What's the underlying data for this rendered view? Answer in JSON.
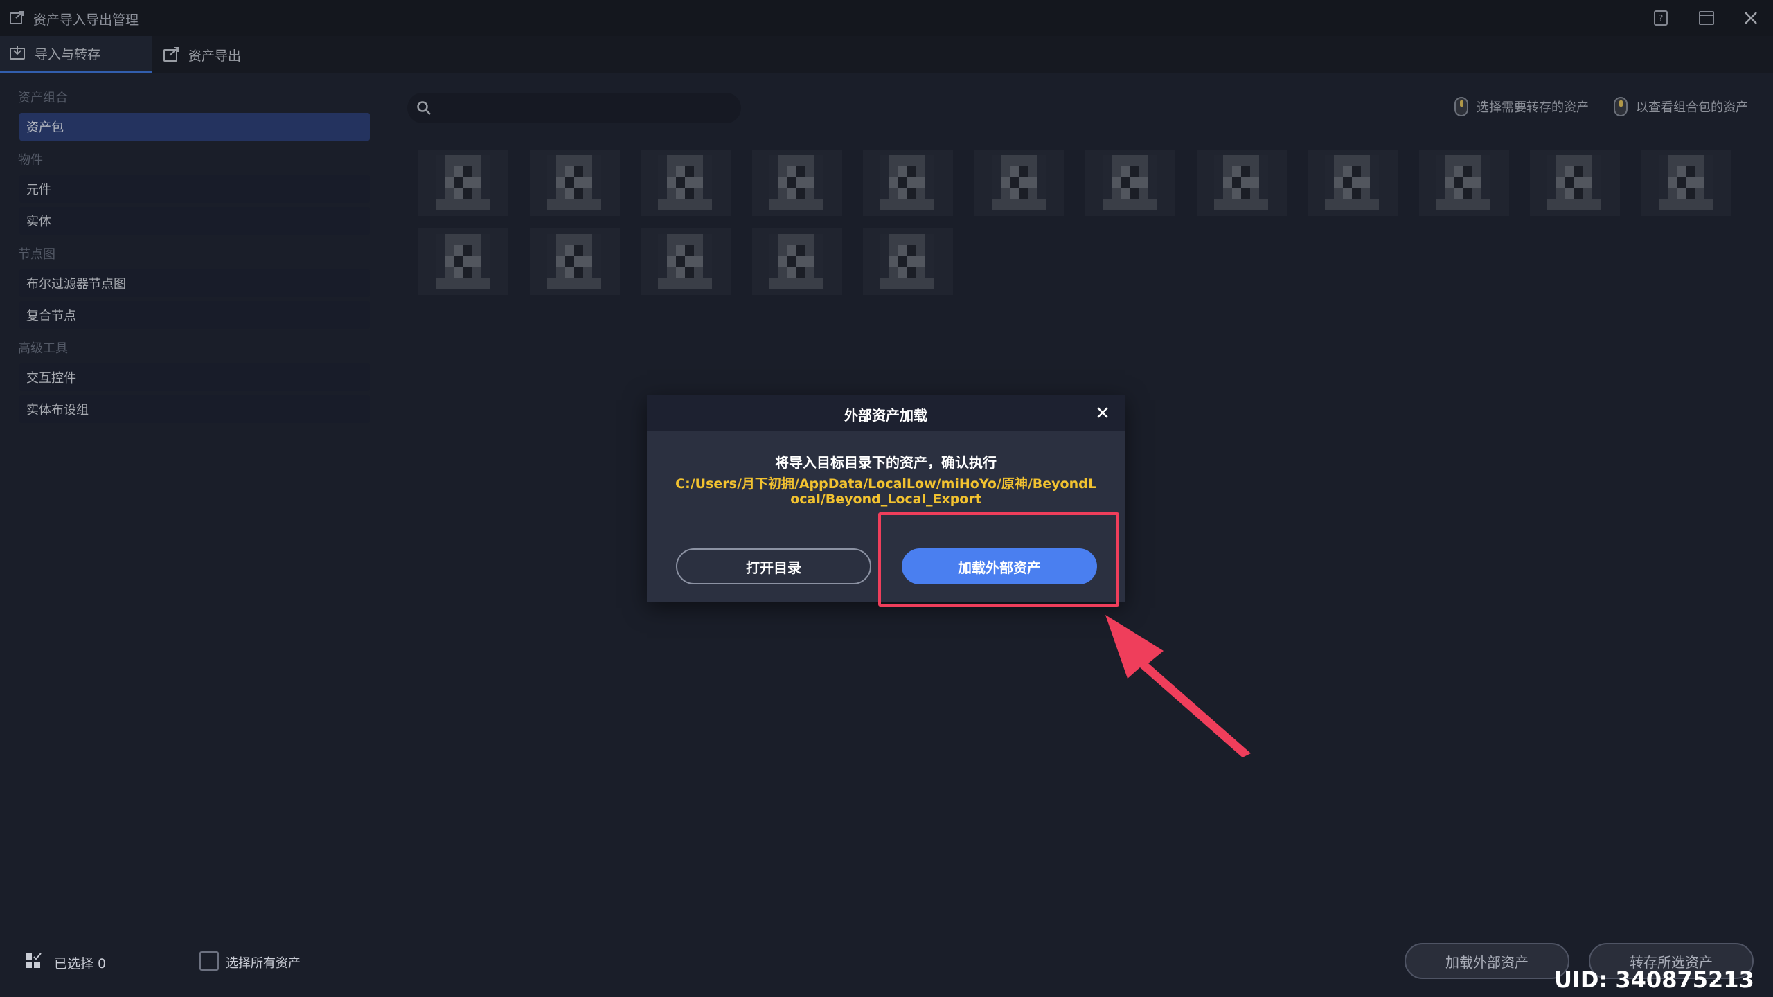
{
  "window": {
    "title": "资产导入导出管理",
    "icons": [
      "export-icon",
      "help-icon",
      "minimize-icon",
      "close-icon"
    ]
  },
  "tabs": [
    {
      "label": "导入与转存",
      "icon": "import-icon",
      "active": true
    },
    {
      "label": "资产导出",
      "icon": "export-icon",
      "active": false
    }
  ],
  "sidebar": {
    "groups": [
      {
        "title": "资产组合",
        "items": [
          {
            "label": "资产包",
            "selected": true
          }
        ]
      },
      {
        "title": "物件",
        "items": [
          {
            "label": "元件"
          },
          {
            "label": "实体"
          }
        ]
      },
      {
        "title": "节点图",
        "items": [
          {
            "label": "布尔过滤器节点图"
          },
          {
            "label": "复合节点"
          }
        ]
      },
      {
        "title": "高级工具",
        "items": [
          {
            "label": "交互控件"
          },
          {
            "label": "实体布设组"
          }
        ]
      }
    ]
  },
  "search": {
    "placeholder": "",
    "value": "",
    "icon": "search-icon"
  },
  "hints": [
    {
      "icon": "mouse-left-icon",
      "label": "选择需要转存的资产"
    },
    {
      "icon": "mouse-right-icon",
      "label": "以查看组合包的资产"
    }
  ],
  "assets": {
    "row1_count": 12,
    "row2_count": 5
  },
  "dialog": {
    "title": "外部资产加载",
    "message": "将导入目标目录下的资产，确认执行",
    "path": "C:/Users/月下初拥/AppData/LocalLow/miHoYo/原神/BeyondLocal/Beyond_Local_Export",
    "open_dir_label": "打开目录",
    "load_label": "加载外部资产"
  },
  "footer": {
    "selected_text": "已选择 0",
    "select_all_label": "选择所有资产",
    "load_external_label": "加载外部资产",
    "transfer_label": "转存所选资产"
  },
  "watermark": {
    "uid": "UID: 340875213"
  },
  "colors": {
    "accent": "#4a7ff0",
    "highlight": "#ef3e5b",
    "path": "#f2c230",
    "sidebar_selected": "#2c3f78"
  }
}
